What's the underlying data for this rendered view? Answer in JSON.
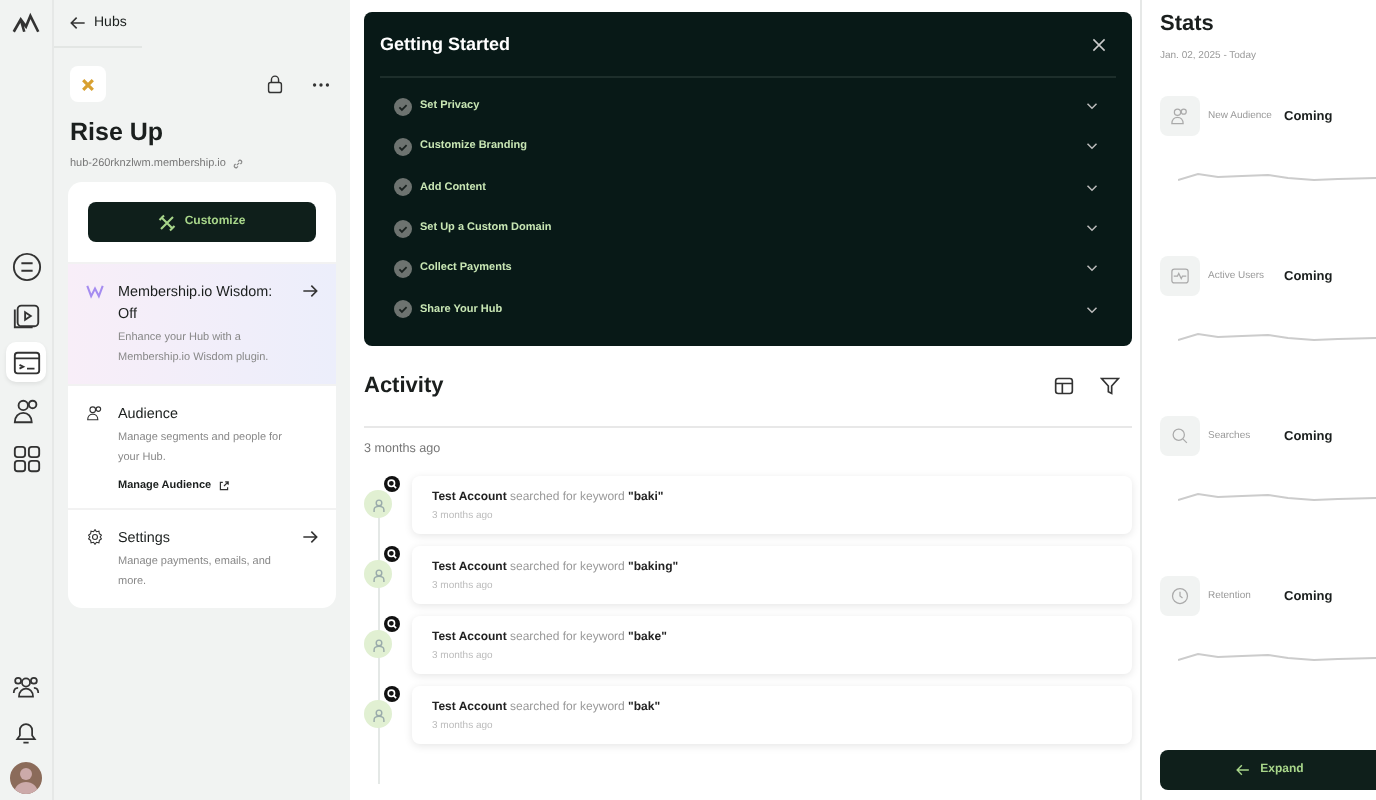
{
  "rail": {
    "items": [
      {
        "kind": "checklist",
        "selected": false
      },
      {
        "kind": "media",
        "selected": false
      },
      {
        "kind": "hub",
        "selected": true
      },
      {
        "kind": "people",
        "selected": false
      },
      {
        "kind": "apps",
        "selected": false
      }
    ],
    "bottom": [
      {
        "kind": "group"
      },
      {
        "kind": "bell"
      }
    ]
  },
  "hub_panel": {
    "back": "Hubs",
    "title": "Rise Up",
    "url": "hub-260rknzlwm.membership.io",
    "customize": "Customize",
    "sections": [
      {
        "kind": "wisdom",
        "title": "Membership.io Wisdom: Off",
        "description": "Enhance your Hub with a Membership.io Wisdom plugin."
      },
      {
        "kind": "audience",
        "title": "Audience",
        "description": "Manage segments and people for your Hub.",
        "link": "Manage Audience"
      },
      {
        "kind": "settings",
        "title": "Settings",
        "description": "Manage payments, emails, and more."
      }
    ]
  },
  "getting_started": {
    "title": "Getting Started",
    "items": [
      {
        "label": "Set Privacy",
        "checked": true
      },
      {
        "label": "Customize Branding",
        "checked": true
      },
      {
        "label": "Add Content",
        "checked": true
      },
      {
        "label": "Set Up a Custom Domain",
        "checked": true
      },
      {
        "label": "Collect Payments",
        "checked": true
      },
      {
        "label": "Share Your Hub",
        "checked": true
      }
    ]
  },
  "activity": {
    "title": "Activity",
    "group": "3 months ago",
    "items": [
      {
        "text": "**Test Account** searched for keyword **\"baki\"**",
        "time": "3 months ago"
      },
      {
        "text": "**Test Account** searched for keyword **\"baking\"**",
        "time": "3 months ago"
      },
      {
        "text": "**Test Account** searched for keyword **\"bake\"**",
        "time": "3 months ago"
      },
      {
        "text": "**Test Account** searched for keyword **\"bak\"**",
        "time": "3 months ago"
      }
    ]
  },
  "stats": {
    "title": "Stats",
    "range": "Jan. 02, 2025 - Today",
    "items": [
      {
        "kind": "audience",
        "label": "New Audience",
        "value": "Coming"
      },
      {
        "kind": "active",
        "label": "Active Users",
        "value": "Coming"
      },
      {
        "kind": "search",
        "label": "Searches",
        "value": "Coming"
      },
      {
        "kind": "retention",
        "label": "Retention",
        "value": "Coming"
      }
    ],
    "expand": "Expand"
  }
}
